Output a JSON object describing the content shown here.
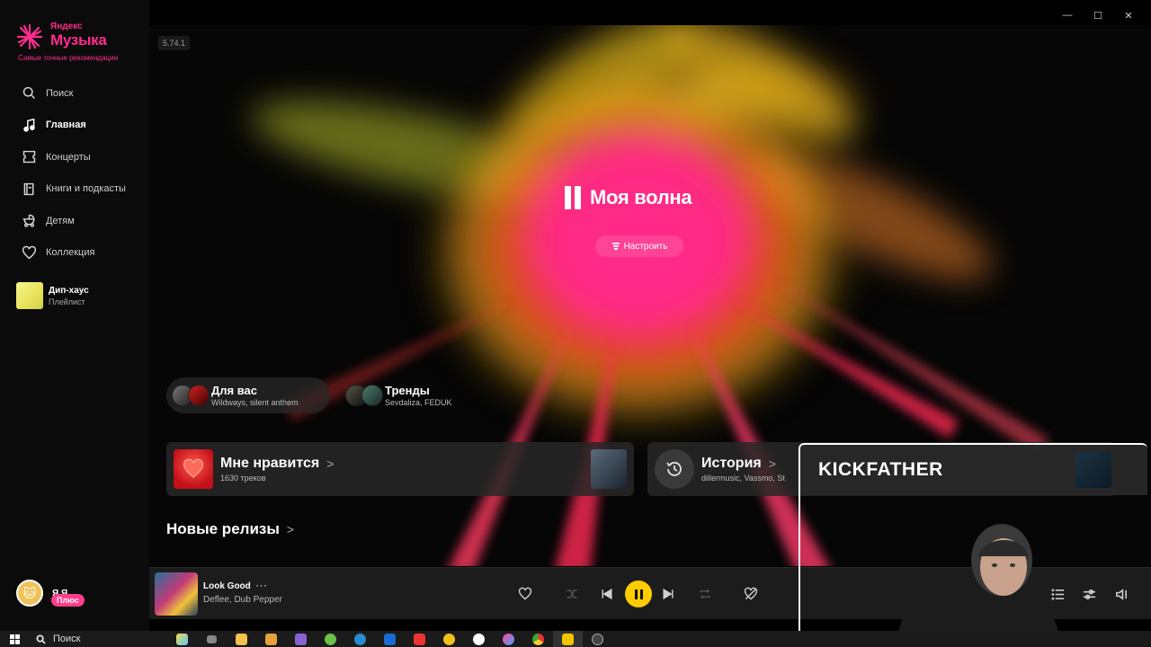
{
  "window": {
    "minimize": "—",
    "maximize": "☐",
    "close": "✕"
  },
  "app": {
    "brand_small": "Яндекс",
    "brand_big": "Музыка",
    "tagline": "Самые точные рекомендации",
    "version": "5.74.1"
  },
  "sidebar": {
    "items": [
      {
        "label": "Поиск",
        "icon": "search-icon"
      },
      {
        "label": "Главная",
        "icon": "music-note-icon",
        "active": true
      },
      {
        "label": "Концерты",
        "icon": "ticket-icon"
      },
      {
        "label": "Книги и подкасты",
        "icon": "book-icon"
      },
      {
        "label": "Детям",
        "icon": "stroller-icon"
      },
      {
        "label": "Коллекция",
        "icon": "heart-icon"
      }
    ],
    "pinned": {
      "title": "Дип-хаус",
      "subtitle": "Плейлист"
    },
    "user": {
      "name": "Я Я",
      "badge": "Плюс"
    }
  },
  "wave": {
    "title": "Моя волна",
    "tune_label": "Настроить"
  },
  "chips": [
    {
      "title": "Для вас",
      "subtitle": "Wildways, silent anthem"
    },
    {
      "title": "Тренды",
      "subtitle": "Sevdaliza, FEDUK"
    }
  ],
  "cards": {
    "likes": {
      "title": "Мне нравится",
      "subtitle": "1630 треков"
    },
    "history": {
      "title": "История",
      "subtitle": "dillermusic, Vassmo, St"
    }
  },
  "sections": {
    "new_releases": "Новые релизы"
  },
  "player": {
    "track": "Look Good",
    "more": "···",
    "artist": "Deflee, Dub Pepper"
  },
  "overlay": {
    "streamer_name": "KICKFATHER"
  },
  "taskbar": {
    "search_label": "Поиск"
  },
  "colors": {
    "accent": "#ffcc00",
    "brand": "#ff2d8e",
    "plus_badge": "#ff3d8b"
  }
}
